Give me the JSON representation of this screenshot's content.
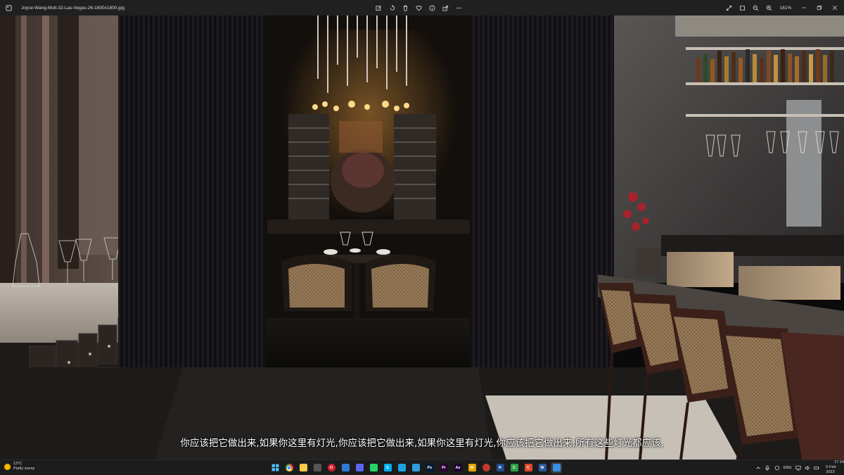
{
  "window": {
    "file_name": "Joyce-Wang-Molt-32-Las-Vegas-26-1800x1800.jpg",
    "zoom": "161%"
  },
  "toolbar": {
    "tools": [
      "edit-icon",
      "rotate-icon",
      "delete-icon",
      "favorite-icon",
      "info-icon",
      "share-icon",
      "more-icon"
    ],
    "view_tools": [
      "fullscreen-icon",
      "fit-icon",
      "zoom-out-icon",
      "zoom-in-icon"
    ]
  },
  "subtitle": "你应该把它做出来,如果你这里有灯光,你应该把它做出来,如果你这里有灯光,你应该把它做出来,所有这些灯光都应该,",
  "taskbar": {
    "weather_temp": "13°C",
    "weather_desc": "Partly sunny",
    "apps": [
      {
        "name": "start",
        "label": "",
        "color": "#4cc2ff"
      },
      {
        "name": "chrome",
        "label": "",
        "color": "#e8453c"
      },
      {
        "name": "file-explorer",
        "label": "",
        "color": "#f7c948"
      },
      {
        "name": "app-dark",
        "label": "",
        "color": "#555555"
      },
      {
        "name": "opera",
        "label": "O",
        "color": "#d2202f"
      },
      {
        "name": "app-blue",
        "label": "",
        "color": "#2e7bd6"
      },
      {
        "name": "discord",
        "label": "",
        "color": "#5865f2"
      },
      {
        "name": "whatsapp",
        "label": "",
        "color": "#25d366"
      },
      {
        "name": "skype",
        "label": "S",
        "color": "#00aff0"
      },
      {
        "name": "app-cyan",
        "label": "",
        "color": "#1fa0e0"
      },
      {
        "name": "app-sky",
        "label": "",
        "color": "#2d9cdb"
      },
      {
        "name": "photoshop",
        "label": "Ps",
        "color": "#001e36"
      },
      {
        "name": "premiere",
        "label": "Pr",
        "color": "#2a0034"
      },
      {
        "name": "after-effects",
        "label": "Ae",
        "color": "#1a0033"
      },
      {
        "name": "app-m",
        "label": "M",
        "color": "#e8a400"
      },
      {
        "name": "app-red-circle",
        "label": "",
        "color": "#c0392b"
      },
      {
        "name": "revit",
        "label": "R",
        "color": "#1f4e8c"
      },
      {
        "name": "app-green",
        "label": "C",
        "color": "#2ea043"
      },
      {
        "name": "app-orange",
        "label": "C",
        "color": "#e0472a"
      },
      {
        "name": "word",
        "label": "W",
        "color": "#2b579a"
      },
      {
        "name": "photos",
        "label": "",
        "color": "#3a8ee6"
      }
    ],
    "lang": "ENG",
    "time": "17:14",
    "date": "6 Feb 2023"
  }
}
